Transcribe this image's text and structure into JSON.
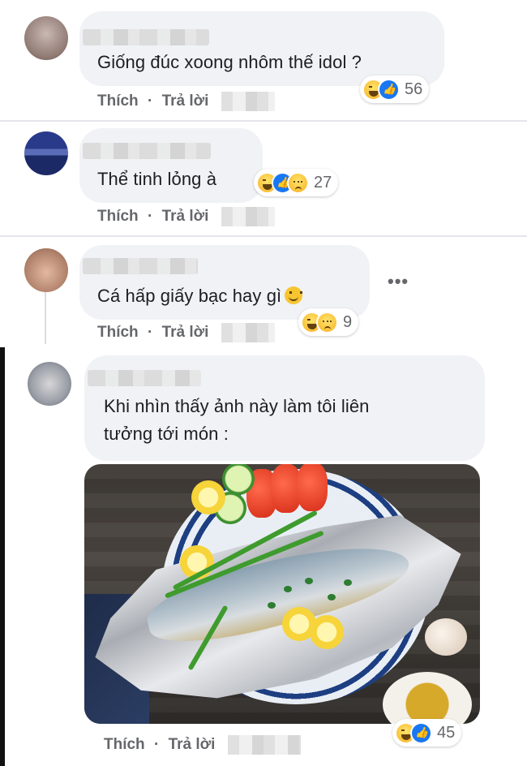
{
  "comments": [
    {
      "text": "Giống đúc xoong nhôm thế idol ?",
      "actions": {
        "like": "Thích",
        "separator": "·",
        "reply": "Trả lời"
      },
      "reactions": {
        "icons": [
          "haha-icon",
          "like-icon"
        ],
        "count": "56"
      }
    },
    {
      "text": "Thể tinh lỏng à",
      "actions": {
        "like": "Thích",
        "separator": "·",
        "reply": "Trả lời"
      },
      "reactions": {
        "icons": [
          "haha-icon",
          "like-icon",
          "sad-icon"
        ],
        "count": "27"
      }
    },
    {
      "text": "Cá hấp giấy bạc hay gì",
      "actions": {
        "like": "Thích",
        "separator": "·",
        "reply": "Trả lời"
      },
      "reactions": {
        "icons": [
          "haha-icon",
          "sad-icon"
        ],
        "count": "9"
      },
      "more": "•••"
    },
    {
      "text": "Khi nhìn thấy ảnh này làm tôi liên tưởng tới món :",
      "text_line1": "Khi nhìn thấy ảnh này làm tôi liên",
      "text_line2": "tưởng tới món :",
      "actions": {
        "like": "Thích",
        "separator": "·",
        "reply": "Trả lời"
      },
      "reactions": {
        "icons": [
          "haha-icon",
          "like-icon"
        ],
        "count": "45"
      }
    }
  ],
  "colors": {
    "bubble": "#f0f2f5",
    "action_text": "#65676b",
    "like_blue": "#1877f2",
    "haha_yellow": "#f7b125"
  }
}
